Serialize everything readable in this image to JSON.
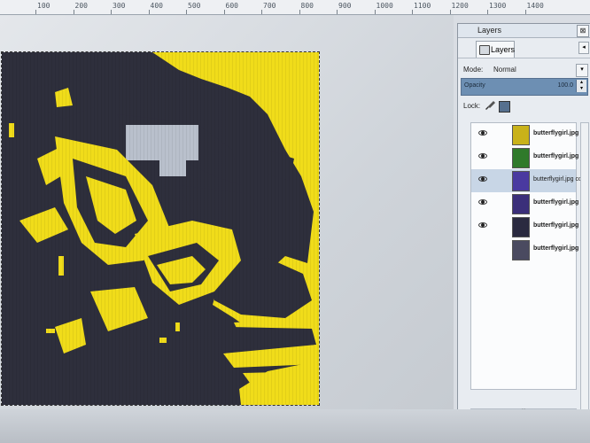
{
  "ruler": {
    "ticks": [
      "100",
      "200",
      "300",
      "400",
      "500",
      "600",
      "700",
      "800",
      "900",
      "1000",
      "1100",
      "1200",
      "1300",
      "1400"
    ]
  },
  "dock": {
    "title": "Layers",
    "close_glyph": "⊠",
    "tab_label": "Layers",
    "tab_menu_glyph": "◂",
    "mode_label": "Mode:",
    "mode_value": "Normal",
    "mode_arrow_glyph": "▾",
    "opacity_label": "Opacity",
    "opacity_value": "100.0",
    "lock_label": "Lock:",
    "scroll_grip": "|||",
    "layers": [
      {
        "name": "butterflygirl.jpg",
        "visible": true,
        "active": false,
        "bold": true,
        "thumb": "#c9b21a"
      },
      {
        "name": "butterflygirl.jpg",
        "visible": true,
        "active": false,
        "bold": true,
        "thumb": "#2f7a2a"
      },
      {
        "name": "butterflygirl.jpg co",
        "visible": true,
        "active": true,
        "bold": false,
        "thumb": "#4a3aa0"
      },
      {
        "name": "butterflygirl.jpg",
        "visible": true,
        "active": false,
        "bold": true,
        "thumb": "#3b2f7a"
      },
      {
        "name": "butterflygirl.jpg",
        "visible": true,
        "active": false,
        "bold": true,
        "thumb": "#2a2a40"
      },
      {
        "name": "butterflygirl.jpg",
        "visible": false,
        "active": false,
        "bold": true,
        "thumb": "#4a4a60"
      }
    ]
  },
  "canvas": {
    "yellow": "#f0dc1a",
    "dark": "#2e2f3c"
  }
}
